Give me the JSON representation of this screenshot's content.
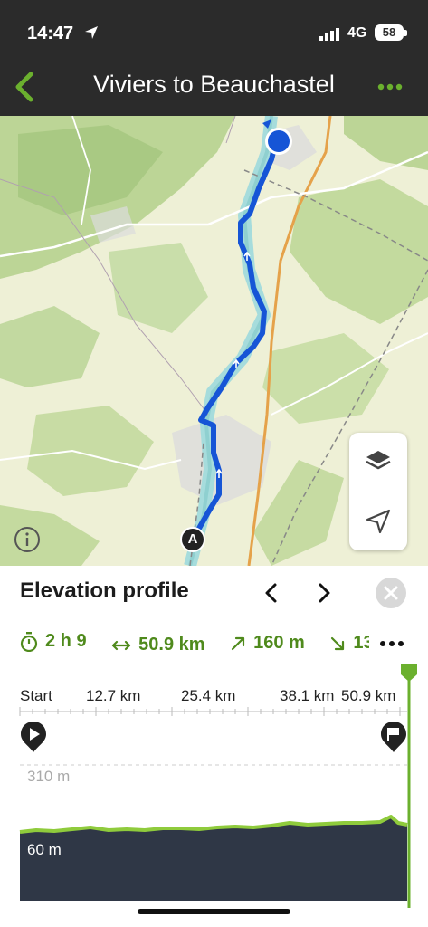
{
  "status_bar": {
    "time": "14:47",
    "network": "4G",
    "battery": "58"
  },
  "nav": {
    "title": "Viviers to Beauchastel"
  },
  "map": {
    "start_label": "A",
    "route_color": "#1655d6",
    "river_color": "#a6dcdc"
  },
  "elevation_panel": {
    "title": "Elevation profile",
    "stats": {
      "duration": "2 h 9",
      "distance": "50.9 km",
      "ascent": "160 m",
      "descent": "13"
    },
    "axis": {
      "labels": [
        "Start",
        "12.7 km",
        "25.4 km",
        "38.1 km",
        "50.9 km"
      ]
    },
    "elevation": {
      "max_label": "310 m",
      "min_label": "60 m"
    }
  },
  "colors": {
    "accent": "#6bb02e",
    "header_bg": "#2b2b2b",
    "chart_fill": "#2f3746",
    "profile_line": "#8fcb3c"
  }
}
